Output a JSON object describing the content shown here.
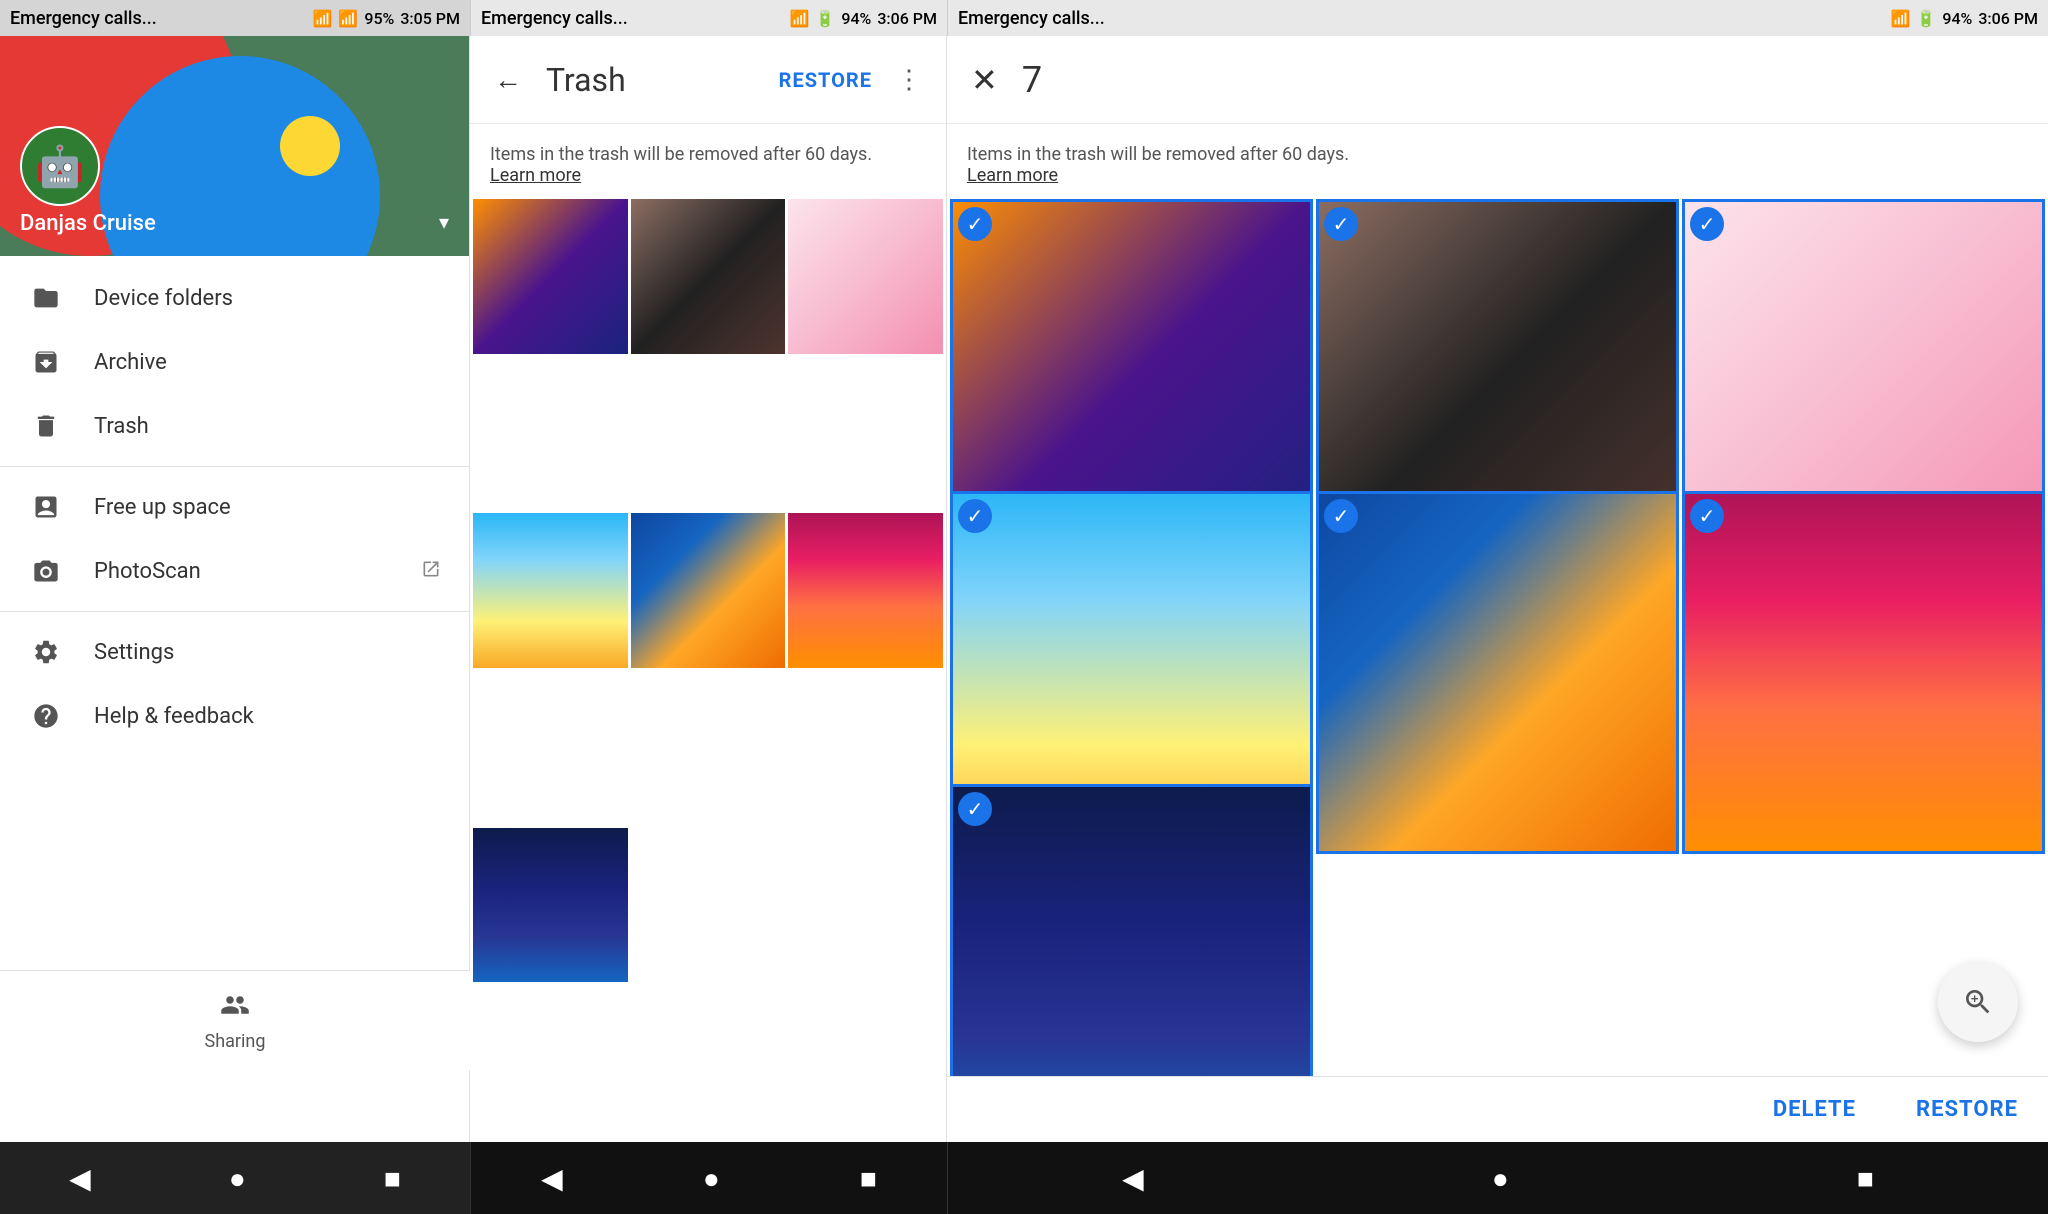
{
  "status_bars": [
    {
      "emergency": "Emergency calls...",
      "time": "3:05 PM",
      "battery": "95%",
      "icons": "📶🔋"
    },
    {
      "emergency": "Emergency calls...",
      "time": "3:06 PM",
      "battery": "94%",
      "icons": "📶🔋"
    },
    {
      "emergency": "Emergency calls...",
      "time": "3:06 PM",
      "battery": "94%",
      "icons": "📶🔋"
    }
  ],
  "drawer": {
    "user_name": "Danjas Cruise",
    "menu_items": [
      {
        "id": "device-folders",
        "label": "Device folders",
        "icon": "folder"
      },
      {
        "id": "archive",
        "label": "Archive",
        "icon": "archive"
      },
      {
        "id": "trash",
        "label": "Trash",
        "icon": "trash"
      },
      {
        "id": "free-up-space",
        "label": "Free up space",
        "icon": "free"
      },
      {
        "id": "photoscan",
        "label": "PhotoScan",
        "icon": "scan",
        "external": true
      },
      {
        "id": "settings",
        "label": "Settings",
        "icon": "settings"
      },
      {
        "id": "help",
        "label": "Help & feedback",
        "icon": "help"
      }
    ],
    "sharing_label": "Sharing"
  },
  "trash_panel": {
    "title": "Trash",
    "restore_label": "RESTORE",
    "info_text": "Items in the trash will be removed after 60 days.",
    "learn_more": "Learn more",
    "photos": [
      {
        "id": 1,
        "type": "autumn"
      },
      {
        "id": 2,
        "type": "crystal"
      },
      {
        "id": 3,
        "type": "floral"
      },
      {
        "id": 4,
        "type": "sunflower"
      },
      {
        "id": 5,
        "type": "fish"
      },
      {
        "id": 6,
        "type": "sunset"
      },
      {
        "id": 7,
        "type": "stars"
      }
    ]
  },
  "selection_panel": {
    "count": "7",
    "info_text": "Items in the trash will be removed after 60 days.",
    "learn_more": "Learn more",
    "delete_label": "Delete",
    "restore_label": "Restore",
    "photos": [
      {
        "id": 1,
        "type": "autumn",
        "selected": true
      },
      {
        "id": 2,
        "type": "crystal",
        "selected": true
      },
      {
        "id": 3,
        "type": "floral",
        "selected": true
      },
      {
        "id": 4,
        "type": "sunflower",
        "selected": true
      },
      {
        "id": 5,
        "type": "fish",
        "selected": true
      },
      {
        "id": 6,
        "type": "sunset",
        "selected": true
      },
      {
        "id": 7,
        "type": "stars",
        "selected": true
      }
    ]
  },
  "nav": {
    "back": "◀",
    "home": "●",
    "square": "■"
  }
}
